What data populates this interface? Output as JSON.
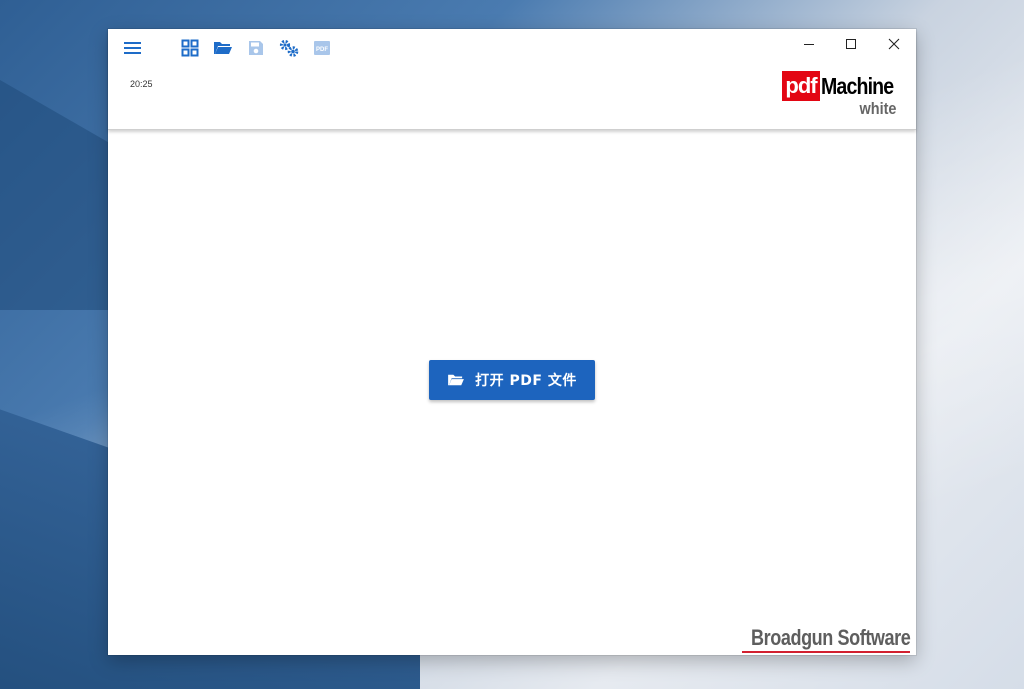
{
  "toolbar": {
    "menu_icon": "hamburger-menu-icon",
    "buttons": [
      {
        "icon": "grid-view-icon",
        "enabled": true
      },
      {
        "icon": "folder-open-icon",
        "enabled": true
      },
      {
        "icon": "save-icon",
        "enabled": false
      },
      {
        "icon": "settings-gears-icon",
        "enabled": true
      },
      {
        "icon": "pdf-icon",
        "enabled": false
      }
    ]
  },
  "status": {
    "time": "20:25"
  },
  "window_controls": {
    "minimize_label": "—",
    "maximize_label": "☐",
    "close_label": "✕"
  },
  "logo": {
    "pdf": "pdf",
    "machine": "Machine",
    "edition": "white"
  },
  "main": {
    "open_button_label": "打开 PDF 文件"
  },
  "footer": {
    "brand": "Broadgun Software"
  },
  "colors": {
    "accent": "#1d64be",
    "icon_active": "#1e6cc8",
    "icon_disabled": "#a9c6ea",
    "logo_red": "#e30613"
  }
}
